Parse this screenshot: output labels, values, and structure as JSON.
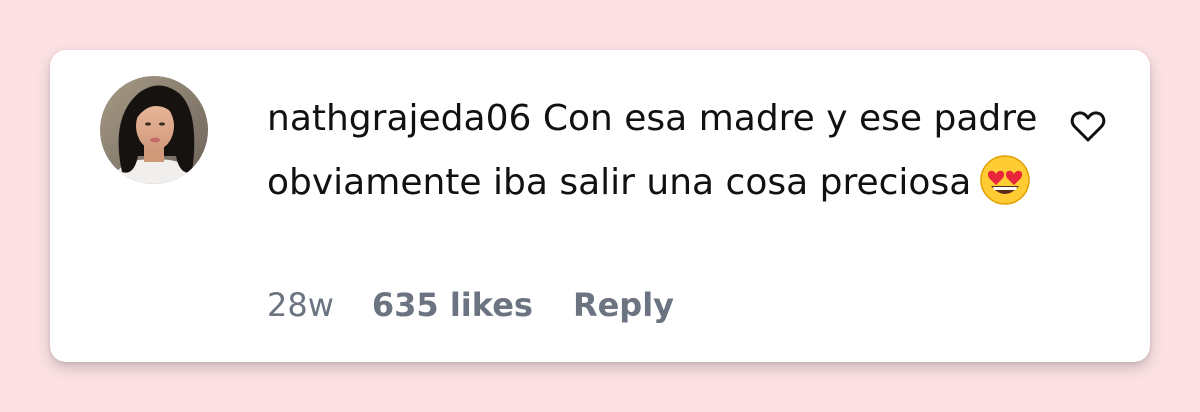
{
  "comment": {
    "username": "nathgrajeda06",
    "text": "Con esa madre y ese padre obviamente iba salir una cosa preciosa",
    "emoji_icon": "heart-eyes-emoji-icon",
    "time": "28w",
    "likes": "635 likes",
    "reply_label": "Reply",
    "like_icon": "heart-outline-icon"
  },
  "colors": {
    "background": "#fbe1e3",
    "card": "#ffffff",
    "text": "#111111",
    "meta": "#6b7480"
  }
}
